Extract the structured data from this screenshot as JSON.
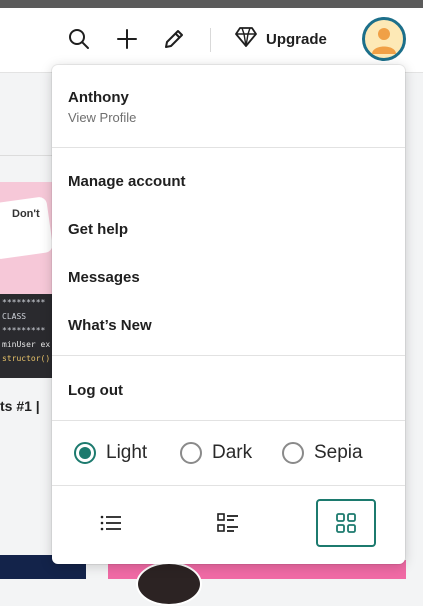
{
  "topbar": {
    "icons": [
      "search-icon",
      "plus-icon",
      "pencil-icon"
    ],
    "upgrade_label": "Upgrade",
    "upgrade_icon": "diamond-icon"
  },
  "background": {
    "card_caption": "ts #1 |",
    "card_banner_text": "Don't",
    "code_lines": [
      "*********",
      "CLASS",
      "*********",
      "minUser ex",
      "structor()"
    ]
  },
  "menu": {
    "profile": {
      "name": "Anthony",
      "link": "View Profile"
    },
    "items": [
      "Manage account",
      "Get help",
      "Messages",
      "What’s New"
    ],
    "logout": "Log out",
    "themes": [
      {
        "label": "Light",
        "selected": true
      },
      {
        "label": "Dark",
        "selected": false
      },
      {
        "label": "Sepia",
        "selected": false
      }
    ],
    "view_modes": [
      {
        "icon": "list-icon",
        "selected": false
      },
      {
        "icon": "checklist-icon",
        "selected": false
      },
      {
        "icon": "grid-icon",
        "selected": true
      }
    ]
  },
  "colors": {
    "accent": "#1c7a6e",
    "avatar_ring": "#1c6f8a",
    "avatar_bg": "#fde9b6",
    "avatar_person": "#f0a046"
  }
}
